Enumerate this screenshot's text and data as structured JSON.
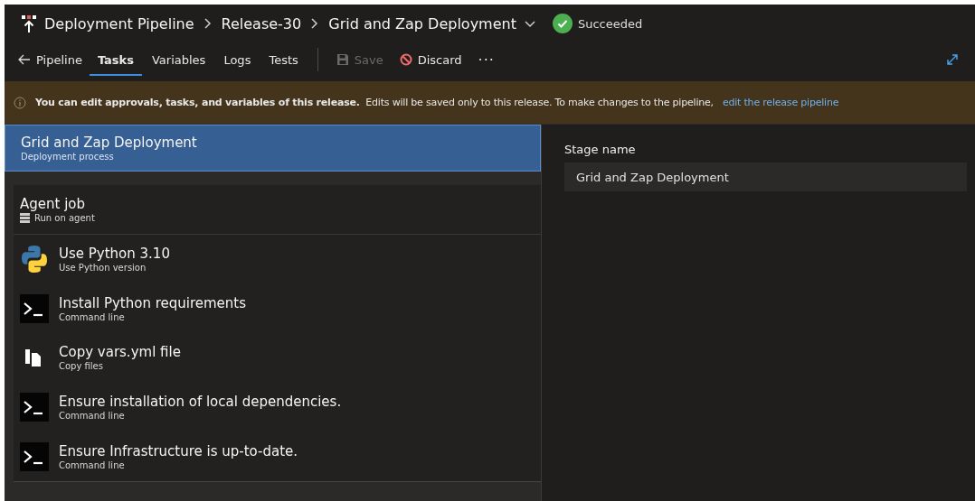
{
  "breadcrumb": [
    {
      "label": "Deployment Pipeline"
    },
    {
      "label": "Release-30"
    },
    {
      "label": "Grid and Zap Deployment",
      "dropdown": true
    }
  ],
  "status": {
    "label": "Succeeded",
    "kind": "succeeded"
  },
  "back_link": {
    "label": "Pipeline"
  },
  "tabs": [
    {
      "label": "Tasks",
      "selected": true
    },
    {
      "label": "Variables",
      "selected": false
    },
    {
      "label": "Logs",
      "selected": false
    },
    {
      "label": "Tests",
      "selected": false
    }
  ],
  "actions": [
    {
      "label": "Save",
      "kind": "save",
      "disabled": true
    },
    {
      "label": "Discard",
      "kind": "discard",
      "disabled": false
    }
  ],
  "more": "···",
  "banner": {
    "bold": "You can edit approvals, tasks, and variables of this release.",
    "text": "Edits will be saved only to this release. To make changes to the pipeline,",
    "link": "edit the release pipeline"
  },
  "stage": {
    "title": "Grid and Zap Deployment",
    "subtitle": "Deployment process",
    "selected": true
  },
  "job": {
    "title": "Agent job",
    "subtitle": "Run on agent"
  },
  "tasks": [
    {
      "title": "Use Python 3.10",
      "subtitle": "Use Python version",
      "kind": "python"
    },
    {
      "title": "Install Python requirements",
      "subtitle": "Command line",
      "kind": "terminal"
    },
    {
      "title": "Copy vars.yml file",
      "subtitle": "Copy files",
      "kind": "copy"
    },
    {
      "title": "Ensure installation of local dependencies.",
      "subtitle": "Command line",
      "kind": "terminal"
    },
    {
      "title": "Ensure Infrastructure is up-to-date.",
      "subtitle": "Command line",
      "kind": "terminal"
    }
  ],
  "stage_name": {
    "label": "Stage name",
    "value": "Grid and Zap Deployment"
  }
}
